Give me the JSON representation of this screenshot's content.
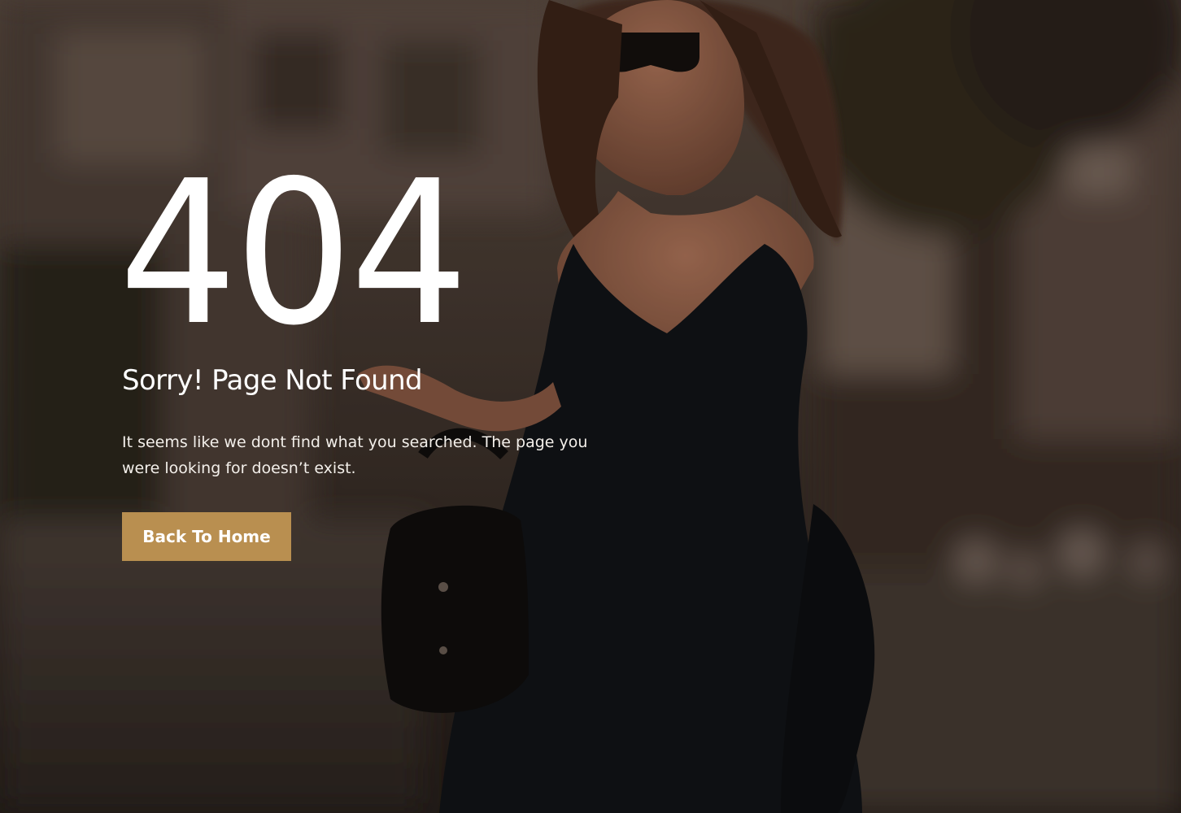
{
  "error_page": {
    "code": "404",
    "title": "Sorry! Page Not Found",
    "description": "It seems like we dont find what you searched. The page you were looking for doesn’t exist.",
    "button_label": "Back To Home"
  },
  "colors": {
    "accent": "#b98f50",
    "text": "#ffffff",
    "background": "#1c1714"
  }
}
